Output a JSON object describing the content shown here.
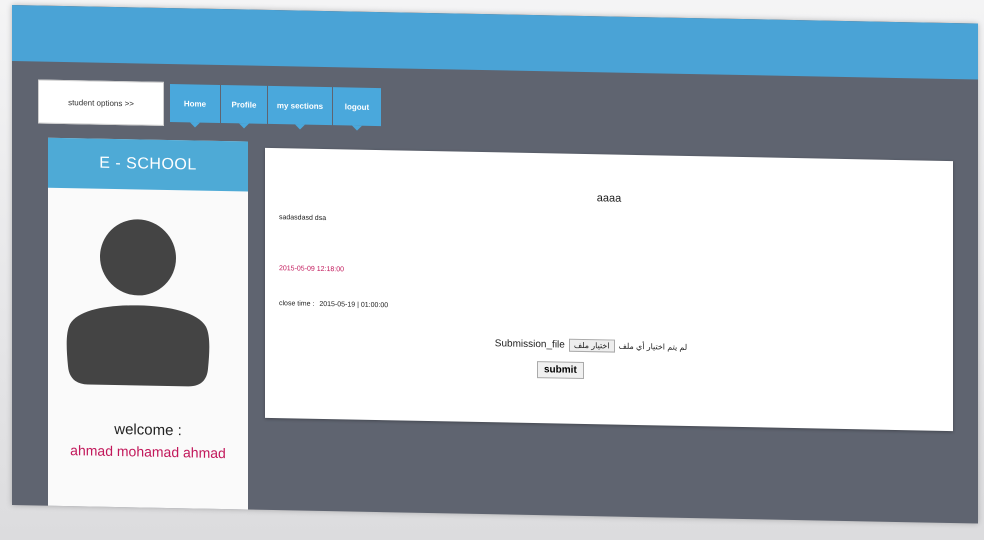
{
  "header": {
    "student_options": "student options >>"
  },
  "nav": {
    "items": [
      "Home",
      "Profile",
      "my sections",
      "logout"
    ]
  },
  "sidebar": {
    "title": "E - SCHOOL",
    "welcome_label": "welcome :",
    "user_name": "ahmad mohamad ahmad"
  },
  "assignment": {
    "title": "aaaa",
    "description": "sadasdasd dsa",
    "open_time": "2015-05-09 12:18:00",
    "close_label": "close time :",
    "close_time": "2015-05-19 | 01:00:00",
    "submission_label": "Submission_file",
    "file_button": "اختيار ملف",
    "file_status": "لم يتم اختيار أي ملف",
    "submit_label": "submit"
  },
  "colors": {
    "accent": "#4aa8dc",
    "background": "#5f6470",
    "name": "#c2185b"
  }
}
